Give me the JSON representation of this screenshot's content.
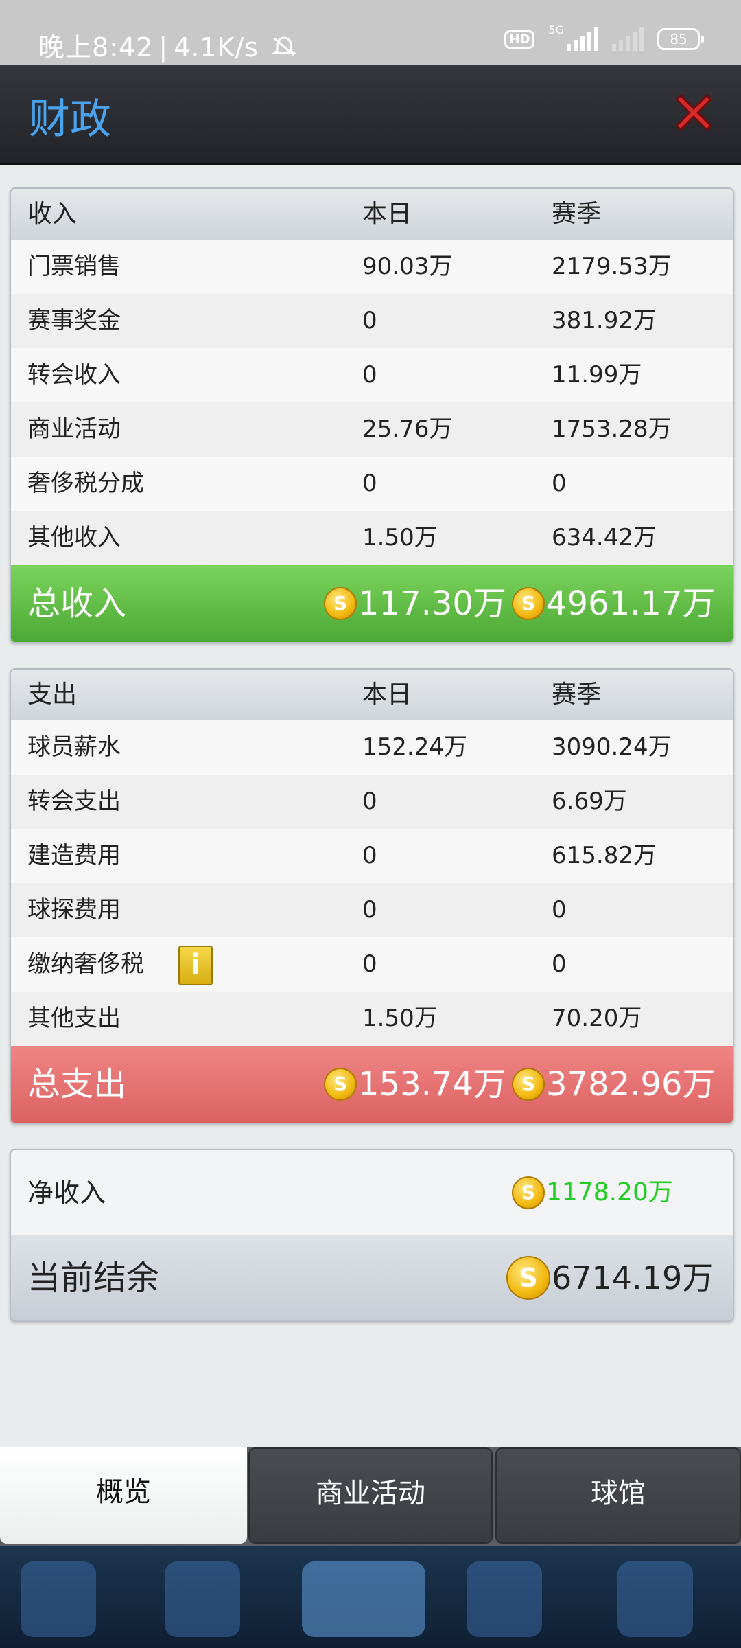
{
  "status_bar": {
    "time": "晚上8:42",
    "speed": "4.1K/s",
    "hd": "HD",
    "network": "5G",
    "battery": "85"
  },
  "header": {
    "title": "财政"
  },
  "income": {
    "header": [
      "收入",
      "本日",
      "赛季"
    ],
    "rows": [
      [
        "门票销售",
        "90.03万",
        "2179.53万"
      ],
      [
        "赛事奖金",
        "0",
        "381.92万"
      ],
      [
        "转会收入",
        "0",
        "11.99万"
      ],
      [
        "商业活动",
        "25.76万",
        "1753.28万"
      ],
      [
        "奢侈税分成",
        "0",
        "0"
      ],
      [
        "其他收入",
        "1.50万",
        "634.42万"
      ]
    ],
    "total": {
      "label": "总收入",
      "today": "117.30万",
      "season": "4961.17万"
    }
  },
  "expense": {
    "header": [
      "支出",
      "本日",
      "赛季"
    ],
    "rows": [
      [
        "球员薪水",
        "152.24万",
        "3090.24万"
      ],
      [
        "转会支出",
        "0",
        "6.69万"
      ],
      [
        "建造费用",
        "0",
        "615.82万"
      ],
      [
        "球探费用",
        "0",
        "0"
      ],
      [
        "缴纳奢侈税",
        "0",
        "0"
      ],
      [
        "其他支出",
        "1.50万",
        "70.20万"
      ]
    ],
    "info_glyph": "i",
    "total": {
      "label": "总支出",
      "today": "153.74万",
      "season": "3782.96万"
    }
  },
  "summary": {
    "net_label": "净收入",
    "net_value": "1178.20万",
    "balance_label": "当前结余",
    "balance_value": "6714.19万"
  },
  "tabs": [
    "概览",
    "商业活动",
    "球馆"
  ],
  "colors": {
    "title_blue": "#4aa3ee",
    "income_green": "#5dbb44",
    "expense_red": "#e56d6d",
    "net_green": "#22cc22"
  }
}
